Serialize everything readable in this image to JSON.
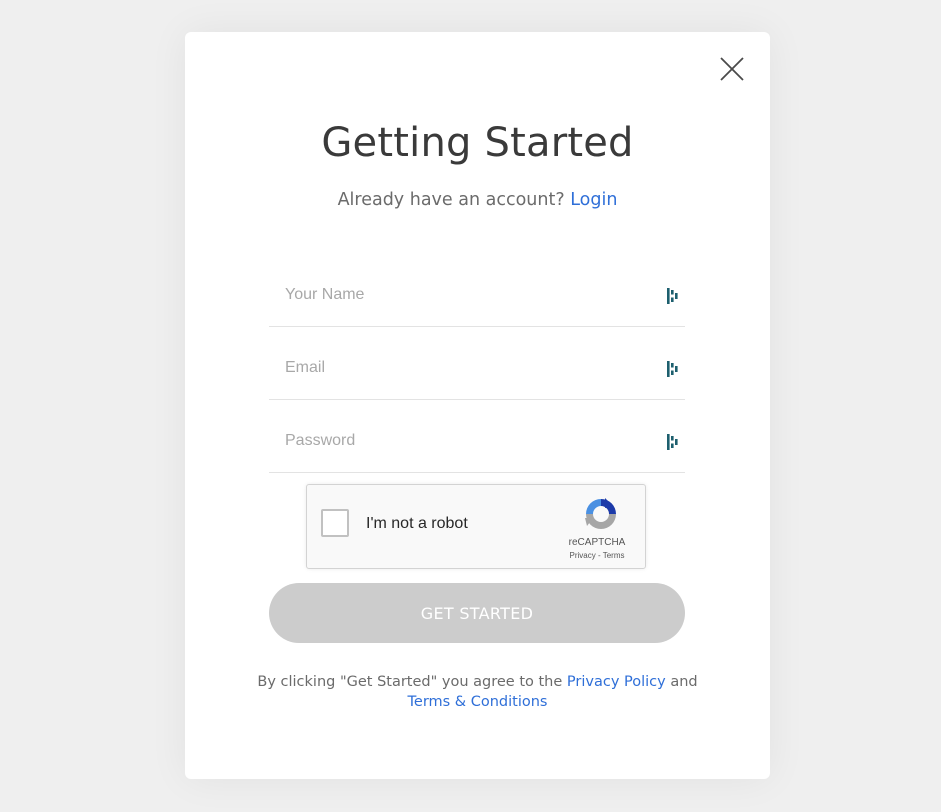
{
  "modal": {
    "title": "Getting Started",
    "subtitle": {
      "text": "Already have an account?",
      "login_link": "Login"
    }
  },
  "form": {
    "name": {
      "placeholder": "Your Name",
      "value": ""
    },
    "email": {
      "placeholder": "Email",
      "value": ""
    },
    "password": {
      "placeholder": "Password",
      "value": ""
    },
    "field_icon": "password-manager-icon"
  },
  "captcha": {
    "label": "I'm not a robot",
    "brand": "reCAPTCHA",
    "privacy": "Privacy",
    "separator": " - ",
    "terms": "Terms",
    "checked": false
  },
  "submit_label": "GET STARTED",
  "footer": {
    "text_before": "By clicking \"Get Started\" you agree to the ",
    "privacy_link": "Privacy Policy",
    "text_middle": " and",
    "terms_link": "Terms & Conditions"
  },
  "colors": {
    "link": "#2f6fd8",
    "button_disabled": "#cccccc",
    "icon_teal": "#1d5f6e",
    "background": "#efefef"
  }
}
